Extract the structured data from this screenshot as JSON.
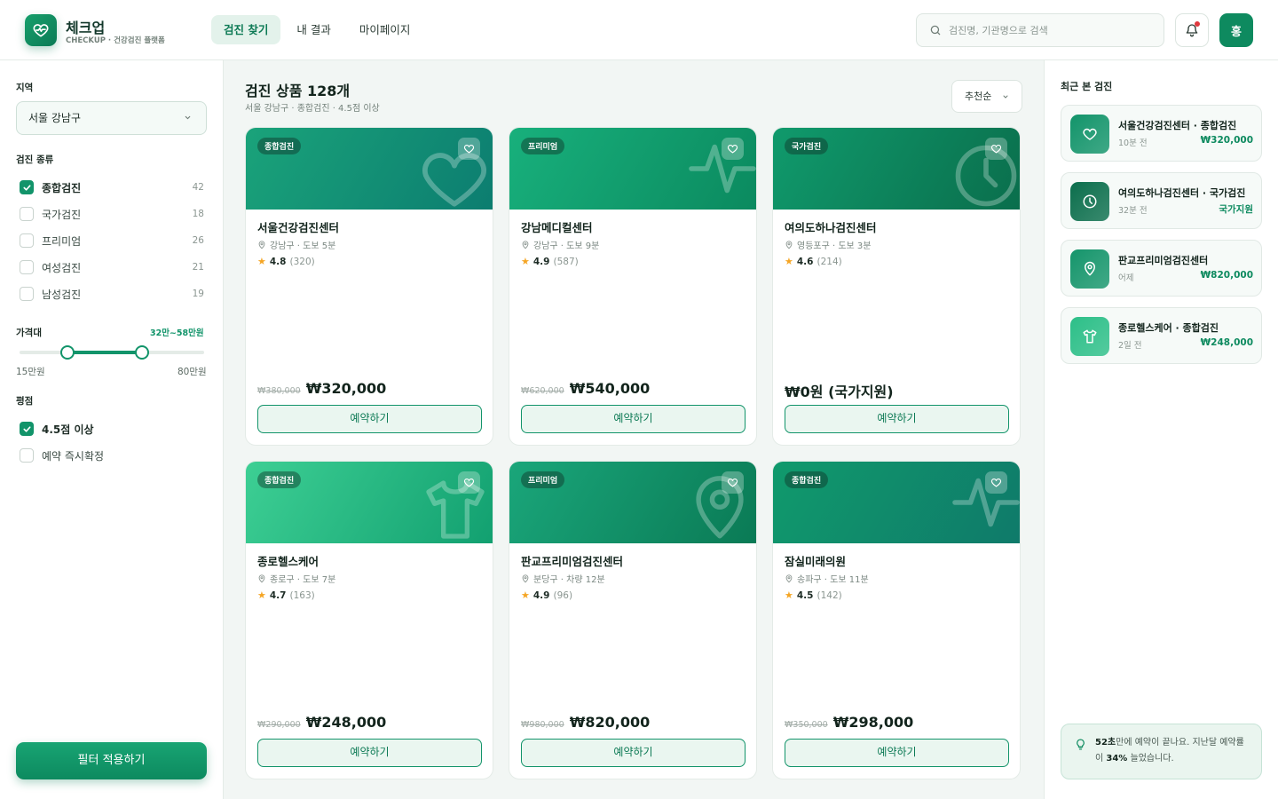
{
  "brand": {
    "name": "체크업",
    "sub": "CHECKUP · 건강검진 플랫폼"
  },
  "nav": {
    "tabs": [
      {
        "label": "검진 찾기"
      },
      {
        "label": "내 결과"
      },
      {
        "label": "마이페이지"
      }
    ]
  },
  "search": {
    "placeholder": "검진명, 기관명으로 검색"
  },
  "user": {
    "avatar": "홍"
  },
  "filters": {
    "region": {
      "heading": "지역",
      "value": "서울 강남구"
    },
    "type": {
      "heading": "검진 종류",
      "options": [
        {
          "label": "종합검진",
          "count": "42",
          "checked": true
        },
        {
          "label": "국가검진",
          "count": "18",
          "checked": false
        },
        {
          "label": "프리미엄",
          "count": "26",
          "checked": false
        },
        {
          "label": "여성검진",
          "count": "21",
          "checked": false
        },
        {
          "label": "남성검진",
          "count": "19",
          "checked": false
        }
      ]
    },
    "price": {
      "heading": "가격대",
      "range_label": "32만~58만원",
      "min_label": "15만원",
      "max_label": "80만원",
      "min": 15,
      "max": 80,
      "low": 32,
      "high": 58
    },
    "rating": {
      "heading": "평점",
      "options": [
        {
          "label": "4.5점 이상",
          "checked": true
        },
        {
          "label": "예약 즉시확정",
          "checked": false
        }
      ]
    },
    "apply_label": "필터 적용하기"
  },
  "results": {
    "title": "검진 상품 128개",
    "subtitle": "서울 강남구 · 종합검진 · 4.5점 이상",
    "sort_label": "추천순",
    "book_label": "예약하기",
    "cards": [
      {
        "badge": "종합검진",
        "name": "서울건강검진센터",
        "location": "강남구 · 도보 5분",
        "rating": "4.8",
        "reviews": "(320)",
        "original_price": "₩380,000",
        "price": "₩320,000",
        "icon": "heart-icon",
        "gradient": [
          "#1aa37a",
          "#0c7d70"
        ]
      },
      {
        "badge": "프리미엄",
        "name": "강남메디컬센터",
        "location": "강남구 · 도보 9분",
        "rating": "4.9",
        "reviews": "(587)",
        "original_price": "₩620,000",
        "price": "₩540,000",
        "icon": "pulse-icon",
        "gradient": [
          "#18b07c",
          "#0b8a5f"
        ]
      },
      {
        "badge": "국가검진",
        "name": "여의도하나검진센터",
        "location": "영등포구 · 도보 3분",
        "rating": "4.6",
        "reviews": "(214)",
        "original_price": "",
        "price": "₩0원 (국가지원)",
        "icon": "clock-icon",
        "gradient": [
          "#109a6c",
          "#0a6e4c"
        ]
      },
      {
        "badge": "종합검진",
        "name": "종로헬스케어",
        "location": "종로구 · 도보 7분",
        "rating": "4.7",
        "reviews": "(163)",
        "original_price": "₩290,000",
        "price": "₩248,000",
        "icon": "shirt-icon",
        "gradient": [
          "#3dcf94",
          "#12a070"
        ]
      },
      {
        "badge": "프리미엄",
        "name": "판교프리미엄검진센터",
        "location": "분당구 · 차량 12분",
        "rating": "4.9",
        "reviews": "(96)",
        "original_price": "₩980,000",
        "price": "₩820,000",
        "icon": "map-pin-icon",
        "gradient": [
          "#1aa67a",
          "#0a7a55"
        ]
      },
      {
        "badge": "종합검진",
        "name": "잠실미래의원",
        "location": "송파구 · 도보 11분",
        "rating": "4.5",
        "reviews": "(142)",
        "original_price": "₩350,000",
        "price": "₩298,000",
        "icon": "pulse-icon",
        "gradient": [
          "#109a6c",
          "#0f7a6a"
        ]
      }
    ]
  },
  "recent": {
    "heading": "최근 본 검진",
    "items": [
      {
        "title": "서울건강검진센터 · 종합검진",
        "time": "10분 전",
        "price": "₩320,000",
        "icon": "heart-icon",
        "color": "#12946a"
      },
      {
        "title": "여의도하나검진센터 · 국가검진",
        "time": "32분 전",
        "price": "국가지원",
        "icon": "clock-icon",
        "color": "#0b6e4c"
      },
      {
        "title": "판교프리미엄검진센터",
        "time": "어제",
        "price": "₩820,000",
        "icon": "map-pin-icon",
        "color": "#15956b"
      },
      {
        "title": "종로헬스케어 · 종합검진",
        "time": "2일 전",
        "price": "₩248,000",
        "icon": "shirt-icon",
        "color": "#2cbf88"
      }
    ],
    "tip": {
      "highlight1": "52초",
      "text1": "만에 예약이 끝나요. 지난달 예약률이 ",
      "highlight2": "34%",
      "text2": " 늘었습니다."
    }
  },
  "colors": {
    "accent": "#12946a",
    "accent_dark": "#0d7a55",
    "star": "#f5a524"
  }
}
